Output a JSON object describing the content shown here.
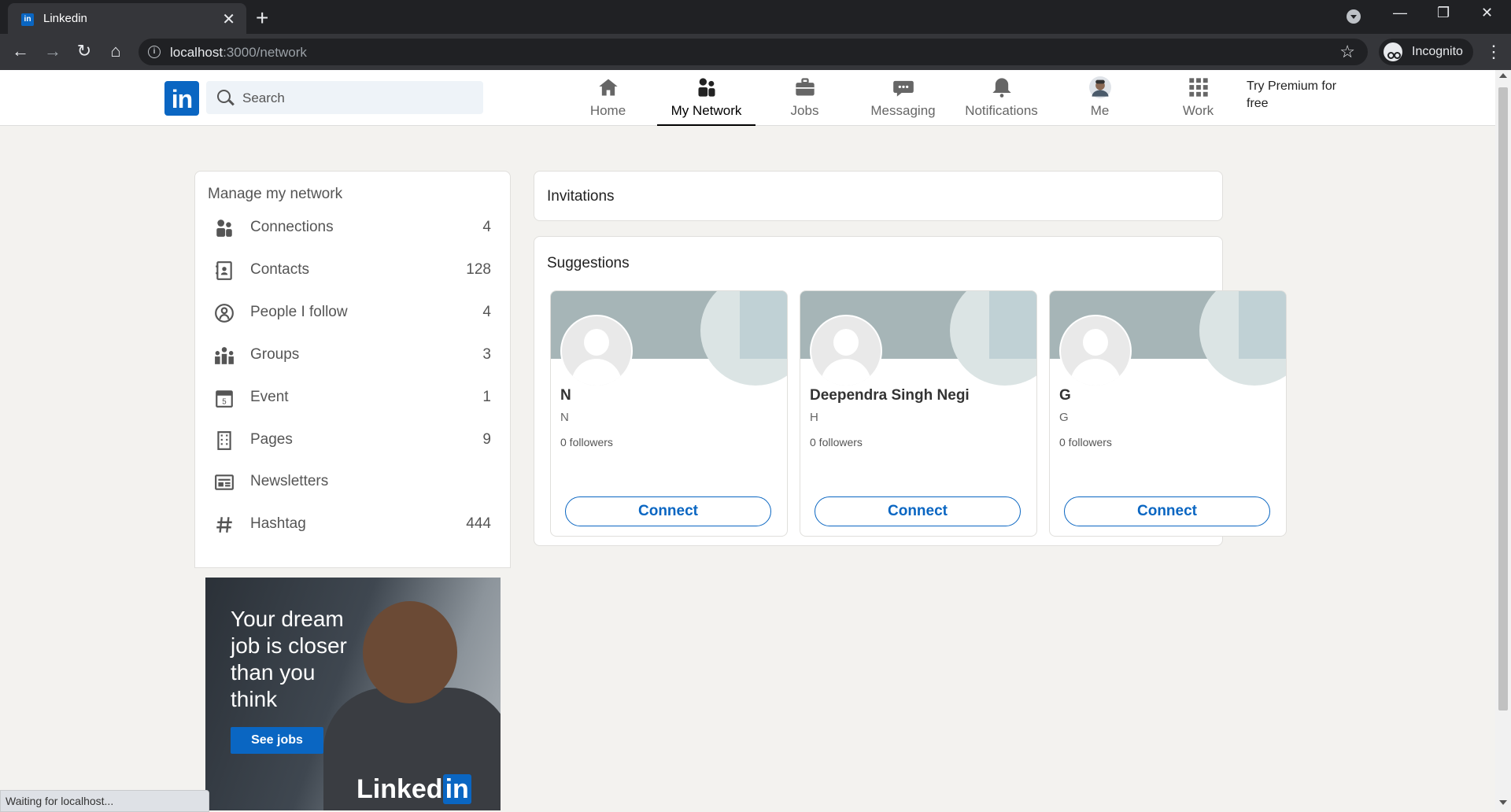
{
  "browser": {
    "tab_title": "Linkedin",
    "tab_favicon": "in",
    "url_host": "localhost",
    "url_rest": ":3000/network",
    "profile_label": "Incognito",
    "status_text": "Waiting for localhost..."
  },
  "nav": {
    "logo": "in",
    "search_placeholder": "Search",
    "items": [
      {
        "label": "Home",
        "icon": "home-icon"
      },
      {
        "label": "My Network",
        "icon": "network-icon",
        "active": true
      },
      {
        "label": "Jobs",
        "icon": "briefcase-icon"
      },
      {
        "label": "Messaging",
        "icon": "chat-icon"
      },
      {
        "label": "Notifications",
        "icon": "bell-icon"
      },
      {
        "label": "Me",
        "icon": "avatar"
      },
      {
        "label": "Work",
        "icon": "grid-icon"
      }
    ],
    "premium_line1": "Try Premium for",
    "premium_line2": "free"
  },
  "sidebar": {
    "title": "Manage my network",
    "items": [
      {
        "label": "Connections",
        "count": "4",
        "icon": "people-icon"
      },
      {
        "label": "Contacts",
        "count": "128",
        "icon": "contact-book-icon"
      },
      {
        "label": "People I follow",
        "count": "4",
        "icon": "follow-icon"
      },
      {
        "label": "Groups",
        "count": "3",
        "icon": "groups-icon"
      },
      {
        "label": "Event",
        "count": "1",
        "icon": "calendar-icon"
      },
      {
        "label": "Pages",
        "count": "9",
        "icon": "building-icon"
      },
      {
        "label": "Newsletters",
        "count": "",
        "icon": "newsletter-icon"
      },
      {
        "label": "Hashtag",
        "count": "444",
        "icon": "hashtag-icon"
      }
    ]
  },
  "ad": {
    "line1": "Your dream",
    "line2": "job is closer",
    "line3": "than you",
    "line4": "think",
    "button": "See jobs",
    "brand_text": "Linked",
    "brand_in": "in"
  },
  "main": {
    "invitations_title": "Invitations",
    "suggestions_title": "Suggestions",
    "suggestions": [
      {
        "name": "N",
        "headline": "N",
        "followers": "0 followers",
        "button": "Connect"
      },
      {
        "name": "Deependra Singh Negi",
        "headline": "H",
        "followers": "0 followers",
        "button": "Connect"
      },
      {
        "name": "G",
        "headline": "G",
        "followers": "0 followers",
        "button": "Connect"
      }
    ]
  },
  "colors": {
    "brand": "#0a66c2",
    "page_bg": "#f3f2ef"
  }
}
